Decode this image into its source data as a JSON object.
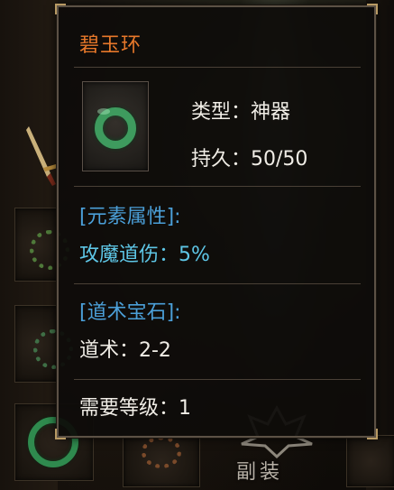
{
  "tooltip": {
    "item_name": "碧玉环",
    "item_icon": "jade-ring-icon",
    "type_line": "类型：神器",
    "durability_line": "持久：50/50",
    "element_header": "[元素属性]:",
    "element_value": "攻魔道伤：5%",
    "gem_header": "[道术宝石]:",
    "gem_value": "道术：2-2",
    "level_req": "需要等级：1"
  },
  "background": {
    "deputy_equip_label": "副装"
  },
  "colors": {
    "item_name": "#e7782a",
    "normal_text": "#f0ede6",
    "section_header": "#4b9fd8",
    "element_value": "#5ec6e6"
  }
}
